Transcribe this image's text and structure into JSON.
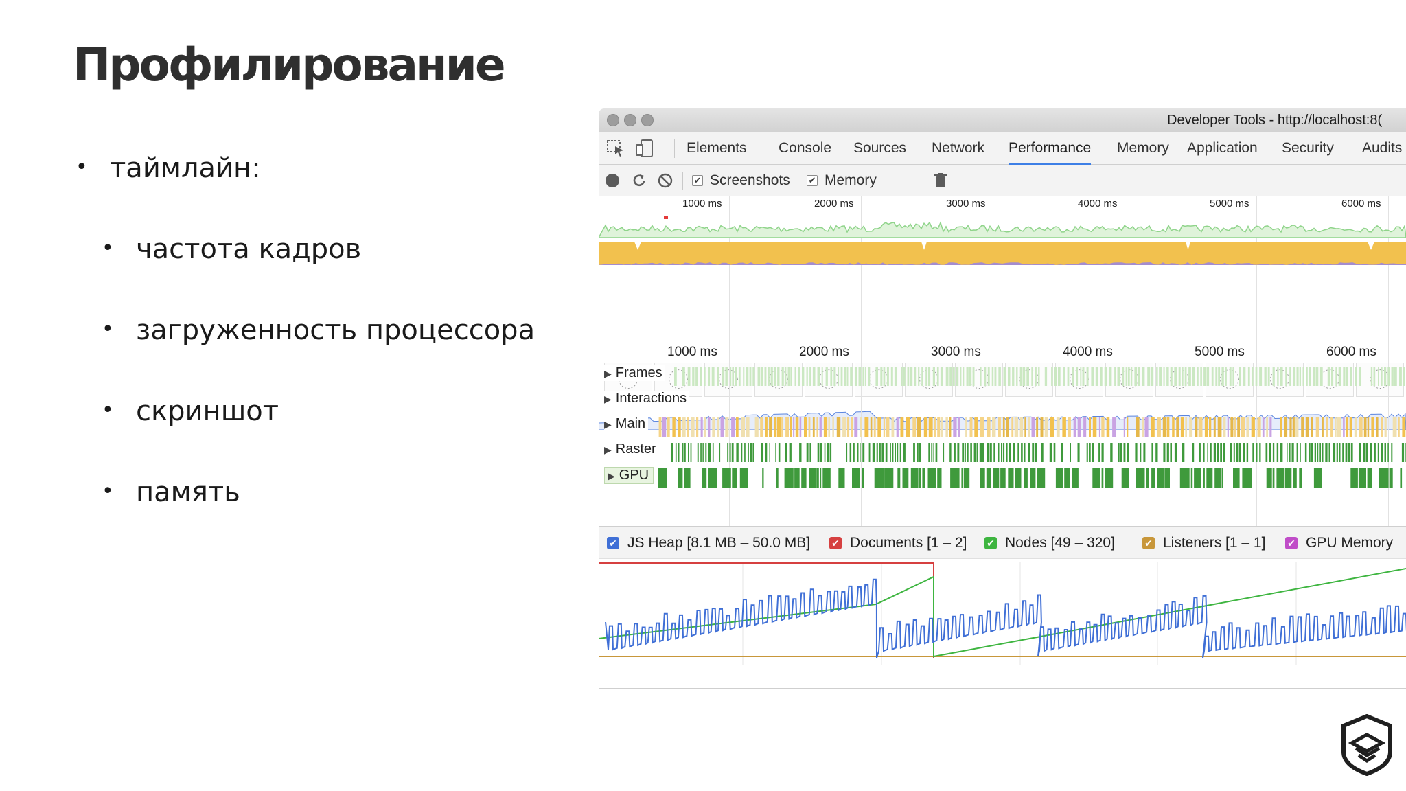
{
  "slide": {
    "title": "Профилирование",
    "bullets": [
      {
        "level": 1,
        "text": "таймлайн:"
      },
      {
        "level": 2,
        "text": "частота кадров"
      },
      {
        "level": 2,
        "text": "загруженность процессора"
      },
      {
        "level": 2,
        "text": "скриншот"
      },
      {
        "level": 2,
        "text": "память"
      }
    ]
  },
  "devtools": {
    "window_title": "Developer Tools - http://localhost:8(",
    "tabs": [
      {
        "label": "Elements",
        "active": false
      },
      {
        "label": "Console",
        "active": false
      },
      {
        "label": "Sources",
        "active": false
      },
      {
        "label": "Network",
        "active": false
      },
      {
        "label": "Performance",
        "active": true
      },
      {
        "label": "Memory",
        "active": false
      },
      {
        "label": "Application",
        "active": false
      },
      {
        "label": "Security",
        "active": false
      },
      {
        "label": "Audits",
        "active": false
      }
    ],
    "toolbar": {
      "screenshots_label": "Screenshots",
      "screenshots_checked": true,
      "memory_label": "Memory",
      "memory_checked": true
    },
    "overview_ruler": [
      "1000 ms",
      "2000 ms",
      "3000 ms",
      "4000 ms",
      "5000 ms",
      "6000 ms"
    ],
    "main_ruler": [
      "1000 ms",
      "2000 ms",
      "3000 ms",
      "4000 ms",
      "5000 ms",
      "6000 ms"
    ],
    "tracks": [
      {
        "label": "Frames"
      },
      {
        "label": "Interactions"
      },
      {
        "label": "Main"
      },
      {
        "label": "Raster"
      },
      {
        "label": "GPU"
      }
    ],
    "memory_legend": [
      {
        "label": "JS Heap [8.1 MB – 50.0 MB]",
        "color": "#3f6fd6",
        "checked": true
      },
      {
        "label": "Documents [1 – 2]",
        "color": "#d64040",
        "checked": true
      },
      {
        "label": "Nodes [49 – 320]",
        "color": "#3eb540",
        "checked": true
      },
      {
        "label": "Listeners [1 – 1]",
        "color": "#c8973a",
        "checked": true
      },
      {
        "label": "GPU Memory",
        "color": "#c04dc8",
        "checked": true
      }
    ],
    "colors": {
      "fps": "#8fd48a",
      "cpu_scripting": "#f2c14e",
      "cpu_rendering": "#9b86de",
      "frames": "#cbe8c2",
      "raster": "#3f9a3c",
      "gpu": "#3f9a3c",
      "accent": "#3d7fe6"
    }
  }
}
